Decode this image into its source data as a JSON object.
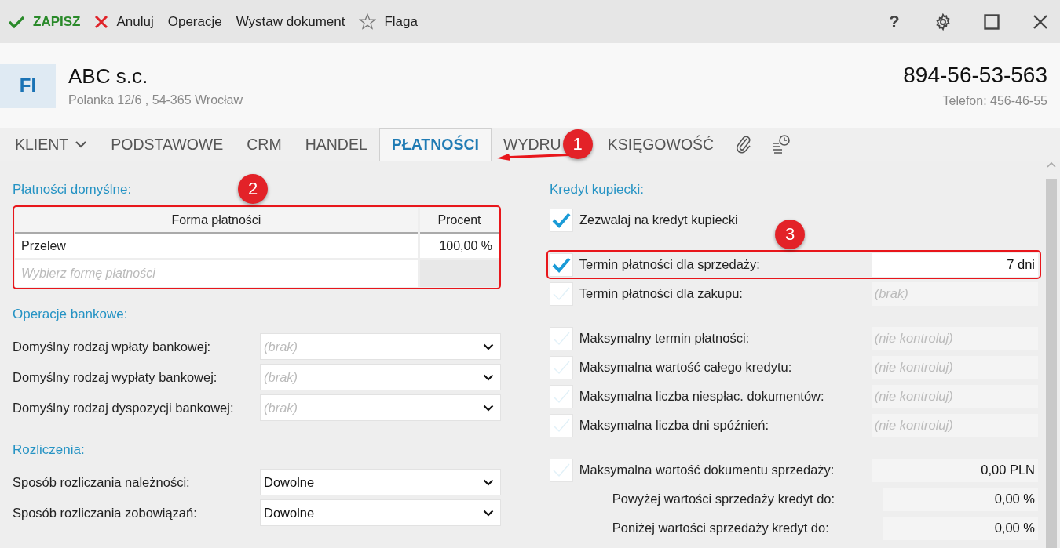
{
  "toolbar": {
    "actions": [
      {
        "kind": "save",
        "label": "ZAPISZ"
      },
      {
        "kind": "cancel",
        "label": "Anuluj"
      },
      {
        "kind": "text",
        "label": "Operacje"
      },
      {
        "kind": "text",
        "label": "Wystaw dokument"
      },
      {
        "kind": "flag",
        "label": "Flaga"
      }
    ],
    "window_controls": [
      {
        "kind": "help",
        "label": "?"
      },
      {
        "kind": "settings"
      },
      {
        "kind": "maximize"
      },
      {
        "kind": "close"
      }
    ]
  },
  "header": {
    "avatar": "FI",
    "name": "ABC s.c.",
    "address": "Polanka  12/6 , 54-365 Wrocław",
    "nip": "894-56-53-563",
    "phone": "Telefon: 456-46-55"
  },
  "tabs": [
    {
      "kind": "dropdown",
      "label": "KLIENT",
      "selected": false
    },
    {
      "kind": "text",
      "label": "PODSTAWOWE",
      "selected": false
    },
    {
      "kind": "text",
      "label": "CRM",
      "selected": false
    },
    {
      "kind": "text",
      "label": "HANDEL",
      "selected": false
    },
    {
      "kind": "text",
      "label": "PŁATNOŚCI",
      "selected": true
    },
    {
      "kind": "text",
      "label": "WYDRU",
      "selected": false,
      "badge": "1"
    },
    {
      "kind": "text",
      "label": "KSIĘGOWOŚĆ",
      "selected": false
    },
    {
      "kind": "attachment",
      "selected": false
    },
    {
      "kind": "history",
      "selected": false
    }
  ],
  "left": {
    "payments": {
      "title": "Płatności domyślne:",
      "highlighted": true,
      "columns": [
        "Forma płatności",
        "Procent"
      ],
      "rows": [
        [
          "Przelew",
          "100,00 %"
        ]
      ],
      "new_row_placeholder": "Wybierz formę płatności"
    },
    "sections": [
      {
        "title": "Operacje bankowe:",
        "fields": [
          {
            "label": "Domyślny rodzaj wpłaty bankowej:",
            "placeholder": "(brak)"
          },
          {
            "label": "Domyślny rodzaj wypłaty bankowej:",
            "placeholder": "(brak)"
          },
          {
            "label": "Domyślny rodzaj dyspozycji bankowej:",
            "placeholder": "(brak)"
          }
        ]
      },
      {
        "title": "Rozliczenia:",
        "fields": [
          {
            "label": "Sposób rozliczania należności:",
            "value": "Dowolne"
          },
          {
            "label": "Sposób rozliczania zobowiązań:",
            "value": "Dowolne"
          }
        ]
      }
    ]
  },
  "right": {
    "title": "Kredyt kupiecki:",
    "groups": [
      [
        {
          "kind": "check",
          "checked": true,
          "label": "Zezwalaj na kredyt kupiecki"
        }
      ],
      [
        {
          "kind": "check",
          "checked": true,
          "label": "Termin płatności dla sprzedaży:",
          "value": "7  dni",
          "highlighted": true
        },
        {
          "kind": "check",
          "checked": false,
          "label": "Termin płatności dla zakupu:",
          "placeholder": "(brak)"
        }
      ],
      [
        {
          "kind": "check",
          "checked": false,
          "label": "Maksymalny termin płatności:",
          "placeholder": "(nie kontroluj)"
        },
        {
          "kind": "check",
          "checked": false,
          "label": "Maksymalna wartość całego kredytu:",
          "placeholder": "(nie kontroluj)"
        },
        {
          "kind": "check",
          "checked": false,
          "label": "Maksymalna liczba niespłac. dokumentów:",
          "placeholder": "(nie kontroluj)"
        },
        {
          "kind": "check",
          "checked": false,
          "label": "Maksymalna liczba dni spóźnień:",
          "placeholder": "(nie kontroluj)"
        }
      ],
      [
        {
          "kind": "check",
          "checked": false,
          "label": "Maksymalna wartość dokumentu sprzedaży:",
          "value": "0,00 PLN"
        },
        {
          "kind": "indent",
          "label": "Powyżej wartości sprzedaży kredyt do:",
          "value": "0,00 %"
        },
        {
          "kind": "indent",
          "label": "Poniżej wartości sprzedaży kredyt do:",
          "value": "0,00 %"
        }
      ]
    ]
  },
  "annotations": [
    {
      "kind": "payments",
      "label": "2"
    },
    {
      "kind": "credit",
      "label": "3"
    }
  ]
}
